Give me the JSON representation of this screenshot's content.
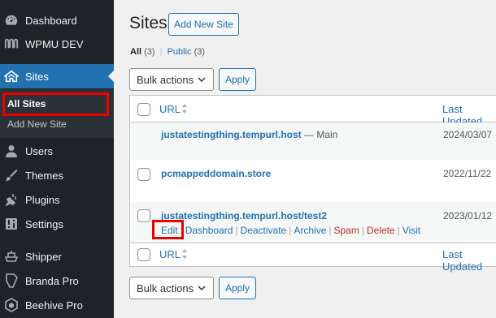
{
  "sidebar": {
    "items": [
      {
        "label": "Dashboard",
        "icon": "dashboard-icon"
      },
      {
        "label": "WPMU DEV",
        "icon": "wpmudev-icon"
      },
      {
        "label": "Sites",
        "icon": "sites-icon"
      },
      {
        "label": "Users",
        "icon": "users-icon"
      },
      {
        "label": "Themes",
        "icon": "themes-icon"
      },
      {
        "label": "Plugins",
        "icon": "plugins-icon"
      },
      {
        "label": "Settings",
        "icon": "settings-icon"
      },
      {
        "label": "Shipper",
        "icon": "shipper-icon"
      },
      {
        "label": "Branda Pro",
        "icon": "branda-icon"
      },
      {
        "label": "Beehive Pro",
        "icon": "beehive-icon"
      }
    ],
    "submenu": [
      {
        "label": "All Sites"
      },
      {
        "label": "Add New Site"
      }
    ]
  },
  "page": {
    "title": "Sites",
    "add_new_label": "Add New Site"
  },
  "filters": {
    "all_label": "All",
    "all_count": "(3)",
    "separator": "|",
    "public_label": "Public",
    "public_count": "(3)"
  },
  "bulk": {
    "select_label": "Bulk actions",
    "apply_label": "Apply"
  },
  "table": {
    "col_url": "URL",
    "col_updated": "Last Updated",
    "rows": [
      {
        "url": "justatestingthing.tempurl.host",
        "note": " — Main",
        "date": "2024/03/07"
      },
      {
        "url": "pcmappeddomain.store",
        "note": "",
        "date": "2022/11/22"
      },
      {
        "url": "justatestingthing.tempurl.host/test2",
        "note": "",
        "date": "2023/01/12"
      }
    ],
    "row_actions": {
      "edit": "Edit",
      "dashboard": "Dashboard",
      "deactivate": "Deactivate",
      "archive": "Archive",
      "spam": "Spam",
      "delete": "Delete",
      "visit": "Visit",
      "sep": "|"
    }
  },
  "colors": {
    "sidebar_bg": "#1d2327",
    "accent": "#2271b1",
    "highlight": "#e00000",
    "danger": "#b32d2e"
  }
}
